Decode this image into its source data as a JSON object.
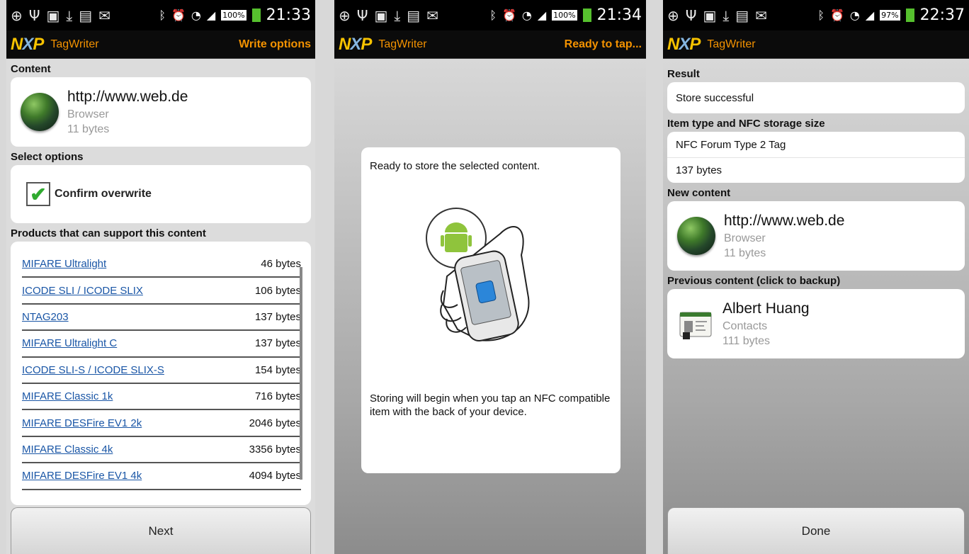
{
  "screens": [
    {
      "status": {
        "battery": "100%",
        "time": "21:33"
      },
      "app": {
        "logo": "NXP",
        "title": "TagWriter",
        "status": "Write options"
      },
      "content_header": "Content",
      "content": {
        "title": "http://www.web.de",
        "type": "Browser",
        "size": "11 bytes",
        "icon": "globe-icon"
      },
      "options_header": "Select options",
      "option": {
        "label": "Confirm overwrite",
        "checked": true
      },
      "products_header": "Products that can support this content",
      "products": [
        {
          "name": "MIFARE Ultralight",
          "size": "46 bytes"
        },
        {
          "name": "ICODE SLI / ICODE SLIX",
          "size": "106 bytes"
        },
        {
          "name": "NTAG203",
          "size": "137 bytes"
        },
        {
          "name": "MIFARE Ultralight C",
          "size": "137 bytes"
        },
        {
          "name": "ICODE SLI-S / ICODE SLIX-S",
          "size": "154 bytes"
        },
        {
          "name": "MIFARE Classic 1k",
          "size": "716 bytes"
        },
        {
          "name": "MIFARE DESFire EV1 2k",
          "size": "2046 bytes"
        },
        {
          "name": "MIFARE Classic 4k",
          "size": "3356 bytes"
        },
        {
          "name": "MIFARE DESFire EV1 4k",
          "size": "4094 bytes"
        }
      ],
      "button": "Next"
    },
    {
      "status": {
        "battery": "100%",
        "time": "21:34"
      },
      "app": {
        "logo": "NXP",
        "title": "TagWriter",
        "status": "Ready to tap..."
      },
      "ready_text": "Ready to store the selected content.",
      "instructions": "Storing will begin when you tap an NFC compatible item with the back of your device."
    },
    {
      "status": {
        "battery": "97%",
        "time": "22:37"
      },
      "app": {
        "logo": "NXP",
        "title": "TagWriter"
      },
      "result_header": "Result",
      "result": "Store successful",
      "item_header": "Item type and NFC storage size",
      "item_type": "NFC Forum Type 2 Tag",
      "item_size": "137 bytes",
      "new_header": "New content",
      "new_content": {
        "title": "http://www.web.de",
        "type": "Browser",
        "size": "11 bytes",
        "icon": "globe-icon"
      },
      "prev_header": "Previous content (click to backup)",
      "prev_content": {
        "title": "Albert Huang",
        "type": "Contacts",
        "size": "111 bytes",
        "icon": "contacts-icon"
      },
      "button": "Done"
    }
  ],
  "colors": {
    "accent": "#f39200",
    "link": "#1a56a6",
    "check": "#2faa2f",
    "battery": "#56c02e"
  }
}
